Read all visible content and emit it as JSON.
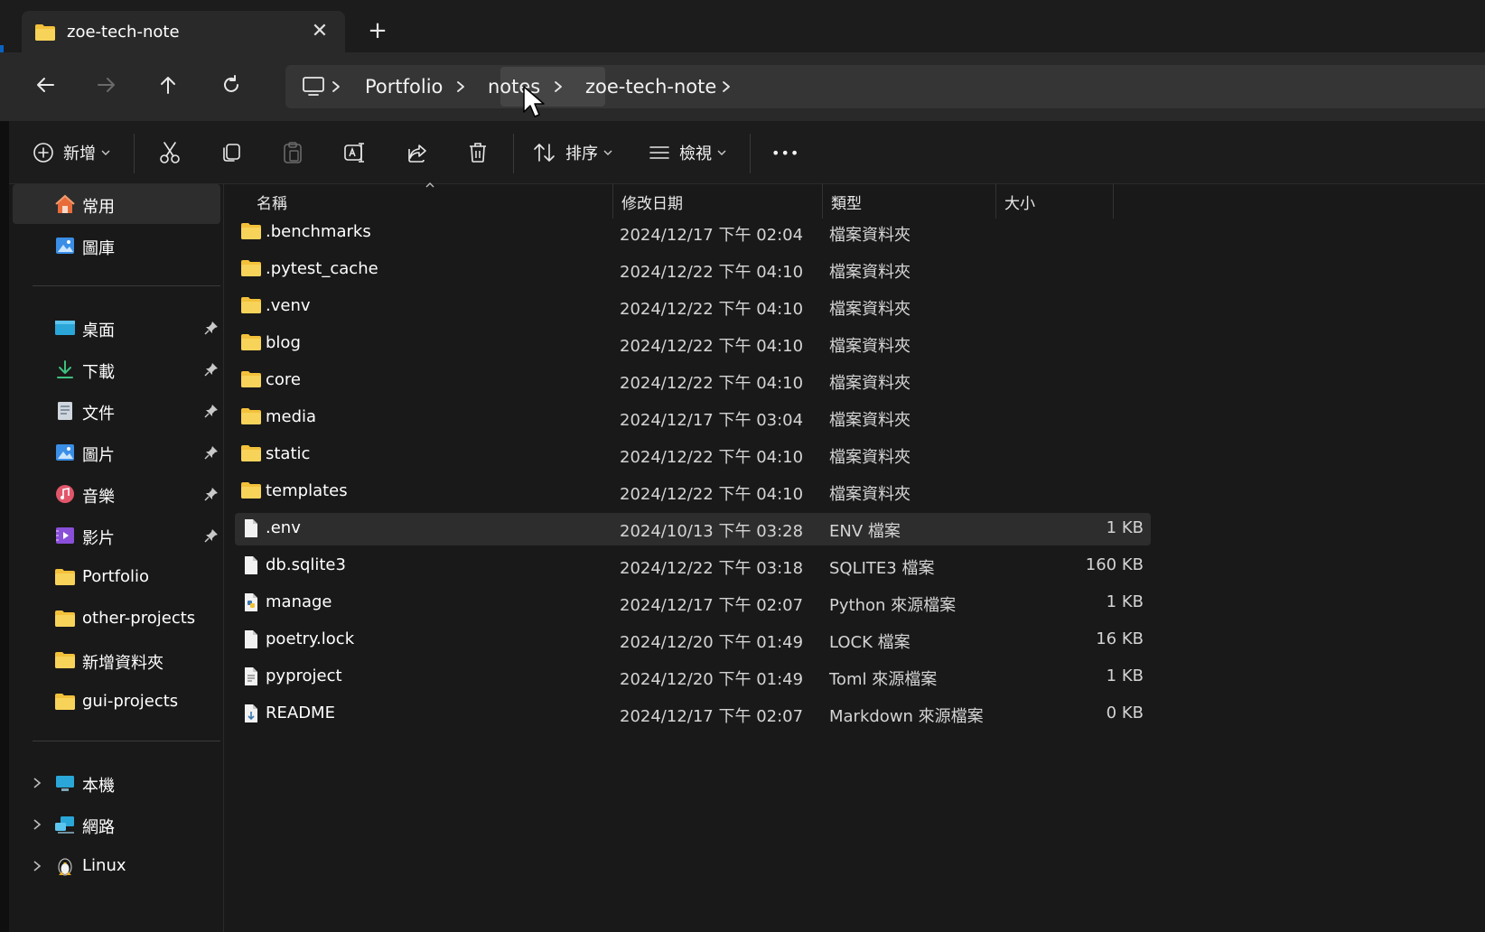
{
  "window": {
    "tab_title": "zoe-tech-note",
    "tab_close": "✕",
    "new_tab": "+"
  },
  "breadcrumb": [
    {
      "label": "Portfolio"
    },
    {
      "label": "notes"
    },
    {
      "label": "zoe-tech-note"
    }
  ],
  "toolbar": {
    "new_label": "新增",
    "sort_label": "排序",
    "view_label": "檢視",
    "more_label": "•••"
  },
  "sidebar": {
    "home": "常用",
    "gallery": "圖庫",
    "pinned": [
      {
        "label": "桌面"
      },
      {
        "label": "下載"
      },
      {
        "label": "文件"
      },
      {
        "label": "圖片"
      },
      {
        "label": "音樂"
      },
      {
        "label": "影片"
      }
    ],
    "folders": [
      {
        "label": "Portfolio"
      },
      {
        "label": "other-projects"
      },
      {
        "label": "新增資料夾"
      },
      {
        "label": "gui-projects"
      }
    ],
    "bottom": [
      {
        "label": "本機"
      },
      {
        "label": "網路"
      },
      {
        "label": "Linux"
      }
    ]
  },
  "columns": {
    "name": "名稱",
    "modified": "修改日期",
    "type": "類型",
    "size": "大小"
  },
  "files": [
    {
      "name": ".benchmarks",
      "modified": "2024/12/17 下午 02:04",
      "type": "檔案資料夾",
      "size": "",
      "icon": "folder-icon"
    },
    {
      "name": ".pytest_cache",
      "modified": "2024/12/22 下午 04:10",
      "type": "檔案資料夾",
      "size": "",
      "icon": "folder-icon"
    },
    {
      "name": ".venv",
      "modified": "2024/12/22 下午 04:10",
      "type": "檔案資料夾",
      "size": "",
      "icon": "folder-icon"
    },
    {
      "name": "blog",
      "modified": "2024/12/22 下午 04:10",
      "type": "檔案資料夾",
      "size": "",
      "icon": "folder-icon"
    },
    {
      "name": "core",
      "modified": "2024/12/22 下午 04:10",
      "type": "檔案資料夾",
      "size": "",
      "icon": "folder-icon"
    },
    {
      "name": "media",
      "modified": "2024/12/17 下午 03:04",
      "type": "檔案資料夾",
      "size": "",
      "icon": "folder-icon"
    },
    {
      "name": "static",
      "modified": "2024/12/22 下午 04:10",
      "type": "檔案資料夾",
      "size": "",
      "icon": "folder-icon"
    },
    {
      "name": "templates",
      "modified": "2024/12/22 下午 04:10",
      "type": "檔案資料夾",
      "size": "",
      "icon": "folder-icon"
    },
    {
      "name": ".env",
      "modified": "2024/10/13 下午 03:28",
      "type": "ENV 檔案",
      "size": "1 KB",
      "icon": "file-icon"
    },
    {
      "name": "db.sqlite3",
      "modified": "2024/12/22 下午 03:18",
      "type": "SQLITE3 檔案",
      "size": "160 KB",
      "icon": "file-icon"
    },
    {
      "name": "manage",
      "modified": "2024/12/17 下午 02:07",
      "type": "Python 來源檔案",
      "size": "1 KB",
      "icon": "python-file-icon"
    },
    {
      "name": "poetry.lock",
      "modified": "2024/12/20 下午 01:49",
      "type": "LOCK 檔案",
      "size": "16 KB",
      "icon": "file-icon"
    },
    {
      "name": "pyproject",
      "modified": "2024/12/20 下午 01:49",
      "type": "Toml 來源檔案",
      "size": "1 KB",
      "icon": "text-file-icon"
    },
    {
      "name": "README",
      "modified": "2024/12/17 下午 02:07",
      "type": "Markdown 來源檔案",
      "size": "0 KB",
      "icon": "markdown-file-icon"
    }
  ],
  "colors": {
    "folder": "#f3c13a",
    "accent": "#0a63c2",
    "selection": "#2d2d2d"
  }
}
